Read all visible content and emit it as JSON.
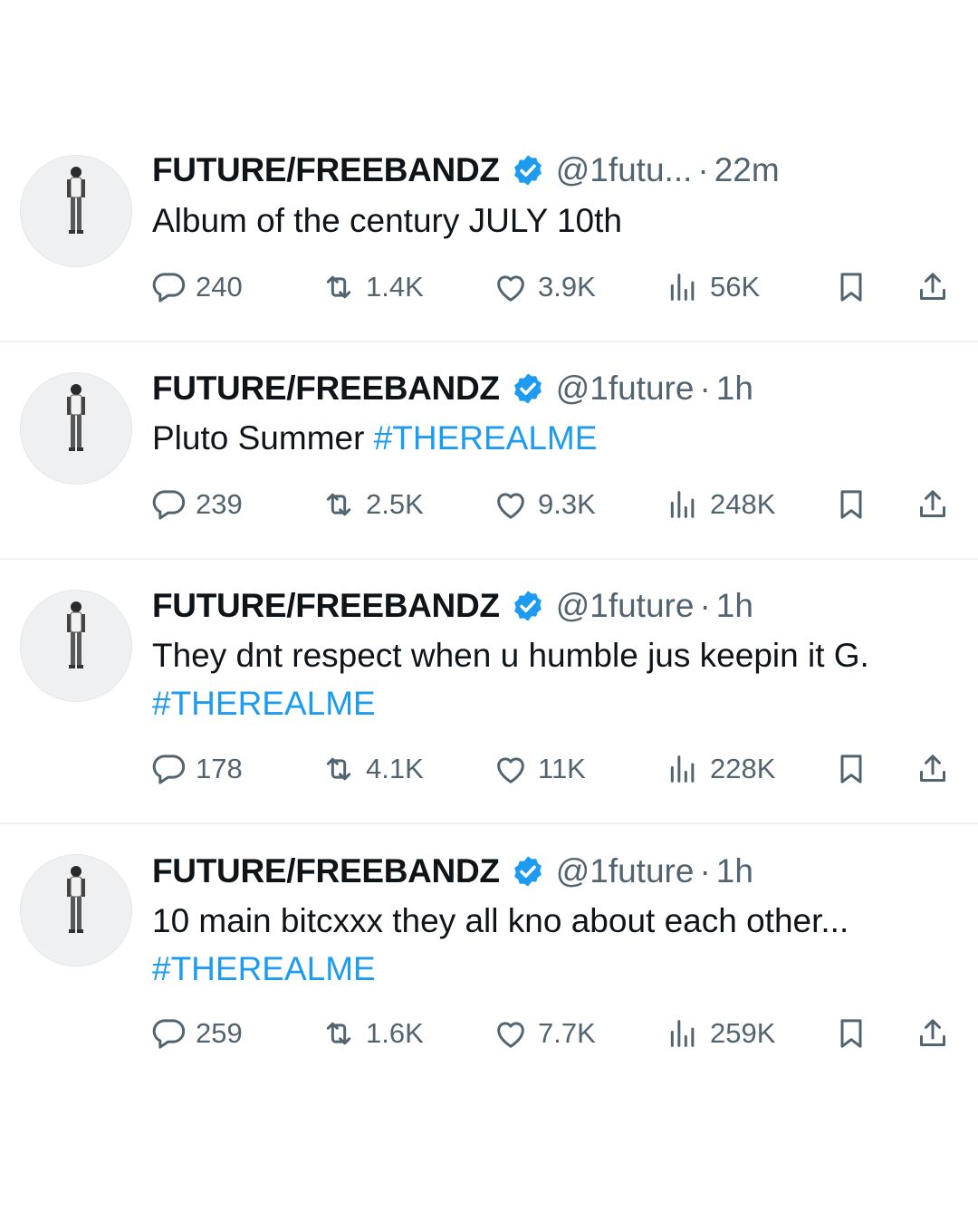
{
  "tweets": [
    {
      "name": "FUTURE/FREEBANDZ",
      "handle": "@1futu...",
      "separator": "·",
      "time": "22m",
      "text": "Album of the century JULY 10th",
      "hashtag": "",
      "replies": "240",
      "reposts": "1.4K",
      "likes": "3.9K",
      "views": "56K"
    },
    {
      "name": "FUTURE/FREEBANDZ",
      "handle": "@1future",
      "separator": "·",
      "time": "1h",
      "text": "Pluto Summer ",
      "hashtag": "#THEREALME",
      "replies": "239",
      "reposts": "2.5K",
      "likes": "9.3K",
      "views": "248K"
    },
    {
      "name": "FUTURE/FREEBANDZ",
      "handle": "@1future",
      "separator": "·",
      "time": "1h",
      "text": "They dnt respect when u humble jus keepin it G. ",
      "hashtag": "#THEREALME",
      "replies": "178",
      "reposts": "4.1K",
      "likes": "11K",
      "views": "228K"
    },
    {
      "name": "FUTURE/FREEBANDZ",
      "handle": "@1future",
      "separator": "·",
      "time": "1h",
      "text": "10 main bitcxxx they all kno about each other... ",
      "hashtag": "#THEREALME",
      "replies": "259",
      "reposts": "1.6K",
      "likes": "7.7K",
      "views": "259K"
    }
  ],
  "icons": {
    "reply": "reply-icon",
    "repost": "repost-icon",
    "like": "like-icon",
    "views": "views-icon",
    "bookmark": "bookmark-icon",
    "share": "share-icon",
    "verified": "verified-badge-icon"
  },
  "colors": {
    "text": "#0f1419",
    "secondary": "#536471",
    "accent": "#1d9bf0",
    "divider": "#eff3f4"
  }
}
